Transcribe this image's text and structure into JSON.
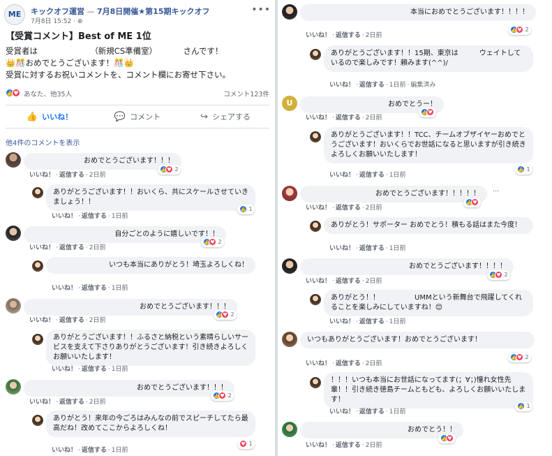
{
  "post": {
    "page_name": "キックオフ運営",
    "separator": "—",
    "event_title": "7月8日開催★第15期キックオフ",
    "date": "7月8日 15:52 ·",
    "logo_text": "ME",
    "heading": "【受賞コメント】Best of ME 1位",
    "line1_prefix": "受賞者は",
    "line1_team": "（新規CS準備室）",
    "line1_suffix": "さんです！",
    "line2": "おめでとうございます！",
    "line3": "受賞に対するお祝いコメントを、コメント欄にお寄せ下さい。",
    "reactions_summary": "あなた、他35人",
    "comment_count": "コメント123件",
    "like_label": "いいね！",
    "comment_label": "コメント",
    "share_label": "シェアする",
    "view_more": "他4件のコメントを表示"
  },
  "labels": {
    "like": "いいね！",
    "reply": "返信する",
    "dot": "·",
    "edited": "編集済み"
  },
  "left_comments": [
    {
      "text": "おめでとうございます！！！",
      "time": "2日前",
      "count": "2"
    },
    {
      "text": "ありがとうございます！！おいくら、共にスケールさせていきましょう！！",
      "time": "1日前",
      "count": "1"
    },
    {
      "text": "自分ごとのように嬉しいです！！",
      "time": "2日前",
      "count": "2"
    },
    {
      "text": "いつも本当にありがとう！埼玉よろしくね！",
      "time": "1日前"
    },
    {
      "text": "おめでとうございます！！！",
      "time": "2日前",
      "count": "2"
    },
    {
      "text": "ありがとうございます！！ふるさと納税という素晴らしいサービスを支えて下さりありがとうございます！引き続きよろしくお願いいたします！",
      "time": "1日前"
    },
    {
      "text": "おめでとうございます！！！",
      "time": "2日前",
      "count": "2"
    },
    {
      "text": "ありがとう！来年の今ごろはみんなの前でスピーチしてたら最高だね！改めてここからよろしくね！",
      "time": "1日前",
      "count": "1"
    }
  ],
  "right_comments": [
    {
      "text": "本当におめでとうございます！！！！",
      "time": "2日前",
      "count": "2"
    },
    {
      "text": "ありがとうございます！！15期、東京は　　　ウェイトしているので楽しみです！頼みます(^^)/",
      "time": "1日前"
    },
    {
      "text": "おめでとうー！",
      "time": "2日前",
      "avatar_letter": "U"
    },
    {
      "text": "ありがとうございます！！TCC、チームオブザイヤーおめでとうございます！おいくらでお世話になると思いますが引き続きよろしくお願いいたします！",
      "time": "1日前",
      "count": "1"
    },
    {
      "text": "おめでとうございます！！！！！",
      "time": "2日前"
    },
    {
      "text": "ありがとう！サポーター おめでとう！積もる話はまた今度！",
      "time": "1日前"
    },
    {
      "text": "おめでとうございます！！！！",
      "time": "2日前",
      "count": "2"
    },
    {
      "text": "ありがとう！！　　　　　UMMという新舞台で飛躍してくれることを楽しみにしていますね！😊",
      "time": "1日前"
    },
    {
      "text": "いつもありがとうございます！おめでとうございます！",
      "time": "2日前",
      "count": "2"
    },
    {
      "text": "！！！いつも本当にお世話になってます(；∀；)憧れ女性先輩！！引き続き徳島チームともども、よろしくお願いいたします！",
      "time": "1日前",
      "count": "1"
    },
    {
      "text": "おめでとう！！",
      "time": "2日前"
    }
  ],
  "colors": {
    "link": "#385898",
    "like_blue": "#1877f2",
    "love_red": "#f33e58",
    "bubble": "#f0f2f5",
    "meta_gray": "#606770"
  }
}
